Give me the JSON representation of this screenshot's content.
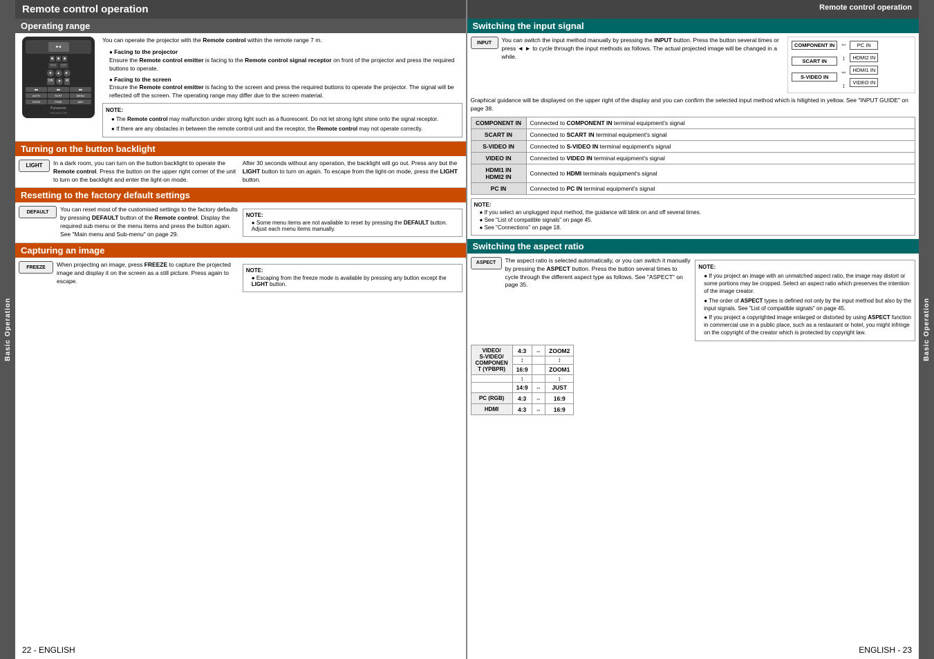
{
  "left_title": "Remote control operation",
  "right_title": "Remote control operation",
  "sidebar_label": "Basic Operation",
  "page_left": "22 - ENGLISH",
  "page_right": "ENGLISH - 23",
  "operating_range": {
    "header": "Operating range",
    "intro": "You can operate the projector with the Remote control within the remote range 7 m.",
    "item1_title": "Facing to the projector",
    "item1_text": "Ensure the Remote control emitter is facing to the Remote control signal receptor on front of the projector and press the required buttons to operate.",
    "item2_title": "Facing to the screen",
    "item2_text": "Ensure the Remote control emitter is facing to the screen and press the required buttons to operate the projector. The signal will be reflected off the screen. The operating range may differ due to the screen material.",
    "note_title": "NOTE:",
    "note1": "The Remote control may malfunction under strong light such as a fluorescent. Do not let strong light shine onto the signal receptor.",
    "note2": "If there are any obstacles in between the remote control unit and the receptor, the Remote control may not operate correctly."
  },
  "turning_backlight": {
    "header": "Turning on the button backlight",
    "icon": "LIGHT",
    "left_text": "In a dark room, you can turn on the button backlight to operate the Remote control. Press the button on the upper right corner of the unit to turn on the backlight and enter the light-on mode.",
    "right_text": "After 30 seconds without any operation, the backlight will go out. Press any but the LIGHT button to turn on again. To escape from the light-on mode, press the LIGHT button."
  },
  "resetting": {
    "header": "Resetting to the factory default settings",
    "icon": "DEFAULT",
    "left_text": "You can reset most of the customised settings to the factory defaults by pressing DEFAULT button of the Remote control. Display the required sub menu or the menu items and press the button again. See \"Main menu and Sub-menu\" on page 29.",
    "note_title": "NOTE:",
    "note1": "Some menu items are not available to reset by pressing the DEFAULT button. Adjust each menu items manually."
  },
  "capturing": {
    "header": "Capturing an image",
    "icon": "FREEZE",
    "left_text": "When projecting an image, press FREEZE to capture the projected image and display it on the screen as a still picture. Press again to escape.",
    "note_title": "NOTE:",
    "note1": "Escaping from the freeze mode is available by pressing any button except the LIGHT button."
  },
  "switching_input": {
    "header": "Switching the input signal",
    "icon": "INPUT",
    "intro": "You can switch the input method manually by pressing the INPUT button. Press the button several times or press ◄ ► to cycle through the input methods as follows. The actual projected image will be changed in a while.",
    "diagram_items_left": [
      "COMPONENT IN",
      "SCART IN",
      "S-VIDEO IN"
    ],
    "diagram_arrows_h": [
      "⇔",
      "⇔"
    ],
    "diagram_arrows_v": [
      "↕",
      "↕",
      "↕"
    ],
    "diagram_items_right": [
      "PC IN",
      "HDMI2 IN",
      "HDMI1 IN",
      "VIDEO IN"
    ],
    "description": "Graphical guidance will be displayed on the upper right of the display and you can confirm the selected input method which is hilighted in yellow. See \"INPUT GUIDE\" on page 38.",
    "table": [
      {
        "label": "COMPONENT IN",
        "desc": "Connected to COMPONENT IN terminal equipment's signal"
      },
      {
        "label": "SCART IN",
        "desc": "Connected to SCART IN terminal equipment's signal"
      },
      {
        "label": "S-VIDEO IN",
        "desc": "Connected to S-VIDEO IN terminal equipment's signal"
      },
      {
        "label": "VIDEO IN",
        "desc": "Connected to VIDEO IN terminal equipment's signal"
      },
      {
        "label": "HDMI1 IN\nHDMI2 IN",
        "desc": "Connected to HDMI terminals equipment's signal"
      },
      {
        "label": "PC IN",
        "desc": "Connected to PC IN terminal equipment's signal"
      }
    ],
    "note_title": "NOTE:",
    "note1": "If you select an unplugged input method, the guidance will blink on and off several times.",
    "note2": "See \"List of compatible signals\" on page 45.",
    "note3": "See \"Connections\" on page 18."
  },
  "switching_aspect": {
    "header": "Switching the aspect ratio",
    "icon": "ASPECT",
    "intro": "The aspect ratio is selected automatically, or you can switch it manually by pressing the ASPECT button. Press the button several times to cycle through the different aspect type as follows. See \"ASPECT\" on page 35.",
    "rows": [
      {
        "label": "VIDEO/\nS-VIDEO/\nCOMPONEN\nT (YPBPR)",
        "options": [
          "4:3",
          "⇔",
          "ZOOM2",
          "↕",
          "↕",
          "16:9",
          "",
          "ZOOM1",
          "↕",
          "↕",
          "14:9",
          "⇔",
          "JUST"
        ]
      },
      {
        "label": "PC (RGB)",
        "options": [
          "4:3",
          "⇔",
          "16:9"
        ]
      },
      {
        "label": "HDMI",
        "options": [
          "4:3",
          "⇔",
          "16:9"
        ]
      }
    ],
    "note_title": "NOTE:",
    "note1": "If you project an image with an unmatched aspect ratio, the image may distort or some portions may be cropped. Select an aspect ratio which preserves the intention of the image creator.",
    "note2": "The order of ASPECT types is defined not only by the input method but also by the input signals. See \"List of compatible signals\" on page 45.",
    "note3": "If you project a copyrighted image enlarged or distorted by using ASPECT function in commercial use in a public place, such as a restaurant or hotel, you might infringe on the copyright of the creator which is protected by copyright law."
  }
}
